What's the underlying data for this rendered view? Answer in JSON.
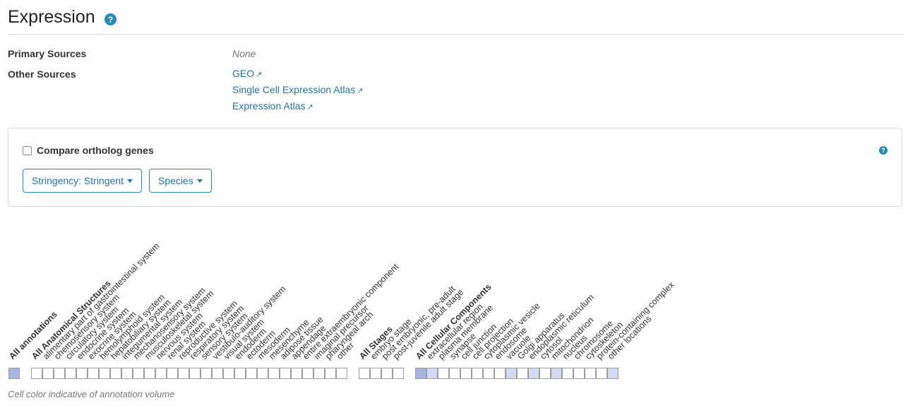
{
  "header": {
    "title": "Expression",
    "help_glyph": "?"
  },
  "sources": {
    "primary_label": "Primary Sources",
    "primary_value": "None",
    "other_label": "Other Sources",
    "links": [
      "GEO",
      "Single Cell Expression Atlas",
      "Expression Atlas"
    ]
  },
  "controls": {
    "compare_label": "Compare ortholog genes",
    "compare_checked": false,
    "stringency_label": "Stringency: Stringent",
    "species_label": "Species"
  },
  "ribbon": {
    "fill_colors": {
      "none": "#ffffff",
      "low": "#d0daf0",
      "high": "#a6b5e3"
    },
    "groups": [
      {
        "columns": [
          {
            "label": "All annotations",
            "bold": true,
            "level": "high"
          }
        ]
      },
      {
        "columns": [
          {
            "label": "All Anatomical Structures",
            "bold": true,
            "level": "none"
          },
          {
            "label": "alimentary part of gastrointestinal system",
            "level": "none"
          },
          {
            "label": "chemosensory system",
            "level": "none"
          },
          {
            "label": "circulatory system",
            "level": "none"
          },
          {
            "label": "endocrine system",
            "level": "none"
          },
          {
            "label": "exocrine system",
            "level": "none"
          },
          {
            "label": "hemolymphoid system",
            "level": "none"
          },
          {
            "label": "hepatobiliary system",
            "level": "none"
          },
          {
            "label": "integumental system",
            "level": "none"
          },
          {
            "label": "mechanosensory system",
            "level": "none"
          },
          {
            "label": "musculoskeletal system",
            "level": "none"
          },
          {
            "label": "nervous system",
            "level": "none"
          },
          {
            "label": "renal system",
            "level": "none"
          },
          {
            "label": "reproductive system",
            "level": "none"
          },
          {
            "label": "respiratory system",
            "level": "none"
          },
          {
            "label": "sensory system",
            "level": "none"
          },
          {
            "label": "vestibulo-auditory system",
            "level": "none"
          },
          {
            "label": "visual system",
            "level": "none"
          },
          {
            "label": "endoderm",
            "level": "none"
          },
          {
            "label": "ectoderm",
            "level": "none"
          },
          {
            "label": "mesoderm",
            "level": "none"
          },
          {
            "label": "mesenchyme",
            "level": "none"
          },
          {
            "label": "adipose tissue",
            "level": "none"
          },
          {
            "label": "appendage",
            "level": "none"
          },
          {
            "label": "entire extraembryonic component",
            "level": "none"
          },
          {
            "label": "imaginal precursor",
            "level": "none"
          },
          {
            "label": "pharyngeal arch",
            "level": "none"
          },
          {
            "label": "other",
            "level": "none"
          }
        ]
      },
      {
        "columns": [
          {
            "label": "All Stages",
            "bold": true,
            "level": "none"
          },
          {
            "label": "embryo stage",
            "level": "none"
          },
          {
            "label": "post embryonic, pre-adult",
            "level": "none"
          },
          {
            "label": "post-juvenile adult stage",
            "level": "none"
          }
        ]
      },
      {
        "columns": [
          {
            "label": "All Cellular Components",
            "bold": true,
            "level": "high"
          },
          {
            "label": "extracellular region",
            "level": "low"
          },
          {
            "label": "plasma membrane",
            "level": "none"
          },
          {
            "label": "synapse",
            "level": "none"
          },
          {
            "label": "cell junction",
            "level": "none"
          },
          {
            "label": "cell projection",
            "level": "none"
          },
          {
            "label": "cytoplasmic vesicle",
            "level": "none"
          },
          {
            "label": "endosome",
            "level": "none"
          },
          {
            "label": "vacuole",
            "level": "low"
          },
          {
            "label": "Golgi apparatus",
            "level": "none"
          },
          {
            "label": "endoplasmic reticulum",
            "level": "low"
          },
          {
            "label": "cytosol",
            "level": "none"
          },
          {
            "label": "mitochondrion",
            "level": "low"
          },
          {
            "label": "nucleus",
            "level": "none"
          },
          {
            "label": "chromosome",
            "level": "none"
          },
          {
            "label": "cytoskeleton",
            "level": "none"
          },
          {
            "label": "protein-containing complex",
            "level": "none"
          },
          {
            "label": "other locations",
            "level": "low"
          }
        ]
      }
    ]
  },
  "caption": "Cell color indicative of annotation volume"
}
